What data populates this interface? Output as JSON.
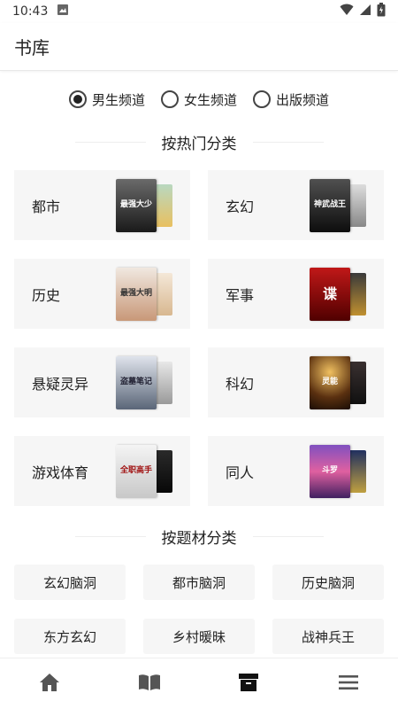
{
  "status": {
    "time": "10:43"
  },
  "header": {
    "title": "书库"
  },
  "channels": [
    {
      "label": "男生频道",
      "selected": true
    },
    {
      "label": "女生频道",
      "selected": false
    },
    {
      "label": "出版频道",
      "selected": false
    }
  ],
  "hot_section": {
    "title": "按热门分类"
  },
  "hot_categories": [
    {
      "name": "都市",
      "cover_text": "最强大少"
    },
    {
      "name": "玄幻",
      "cover_text": "神武战王"
    },
    {
      "name": "历史",
      "cover_text": "最强大明"
    },
    {
      "name": "军事",
      "cover_text": "谍"
    },
    {
      "name": "悬疑灵异",
      "cover_text": "盗墓笔记"
    },
    {
      "name": "科幻",
      "cover_text": "灵能"
    },
    {
      "name": "游戏体育",
      "cover_text": "全职高手"
    },
    {
      "name": "同人",
      "cover_text": "斗罗"
    }
  ],
  "theme_section": {
    "title": "按题材分类"
  },
  "theme_categories": [
    "玄幻脑洞",
    "都市脑洞",
    "历史脑洞",
    "东方玄幻",
    "乡村暖昧",
    "战神兵王"
  ],
  "bottom_nav": [
    "home-icon",
    "book-open-icon",
    "archive-icon",
    "menu-icon"
  ],
  "colors": {
    "accent": "#222222",
    "card_bg": "#f6f6f6"
  }
}
